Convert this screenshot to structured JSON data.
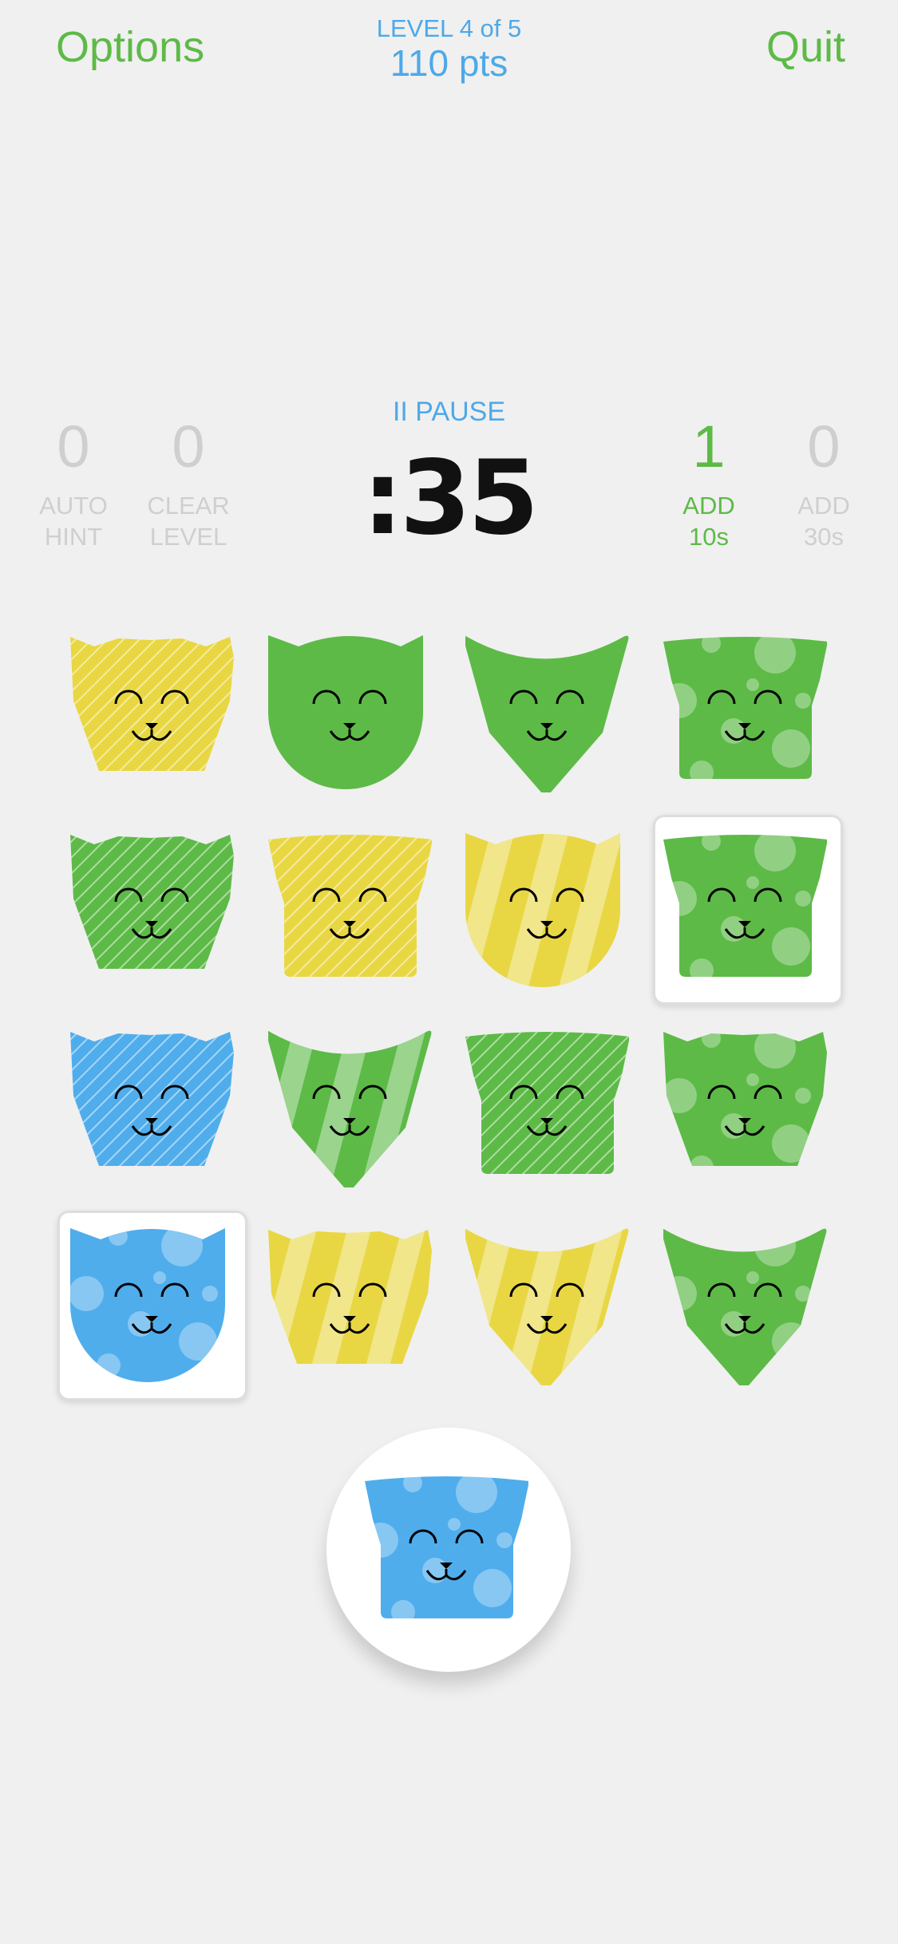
{
  "header": {
    "options_label": "Options",
    "quit_label": "Quit",
    "level_text": "LEVEL 4 of 5",
    "points_text": "110 pts"
  },
  "powerups": [
    {
      "count": "0",
      "line1": "AUTO",
      "line2": "HINT",
      "active": false
    },
    {
      "count": "0",
      "line1": "CLEAR",
      "line2": "LEVEL",
      "active": false
    },
    {
      "count": "1",
      "line1": "ADD",
      "line2": "10s",
      "active": true
    },
    {
      "count": "0",
      "line1": "ADD",
      "line2": "30s",
      "active": false
    }
  ],
  "timer": {
    "pause_label": "II PAUSE",
    "time_text": ":35"
  },
  "colors": {
    "green": "#5dba47",
    "yellow": "#e8d743",
    "blue": "#4fadec",
    "accent_blue": "#4da9e8",
    "inactive_grey": "#cfcfcf"
  },
  "grid": [
    {
      "shape": "pointy-ears",
      "color": "yellow",
      "pattern": "lines",
      "selected": false
    },
    {
      "shape": "round-ears",
      "color": "green",
      "pattern": "plain",
      "selected": false
    },
    {
      "shape": "v-wide",
      "color": "green",
      "pattern": "plain",
      "selected": false
    },
    {
      "shape": "box-taper",
      "color": "green",
      "pattern": "dots",
      "selected": false
    },
    {
      "shape": "pointy-ears",
      "color": "green",
      "pattern": "lines",
      "selected": false
    },
    {
      "shape": "box-taper",
      "color": "yellow",
      "pattern": "lines",
      "selected": false
    },
    {
      "shape": "round-ears",
      "color": "yellow",
      "pattern": "stripes",
      "selected": false
    },
    {
      "shape": "box-taper",
      "color": "green",
      "pattern": "dots",
      "selected": true
    },
    {
      "shape": "pointy-ears",
      "color": "blue",
      "pattern": "lines",
      "selected": false
    },
    {
      "shape": "v-wide",
      "color": "green",
      "pattern": "stripes",
      "selected": false
    },
    {
      "shape": "box-taper",
      "color": "green",
      "pattern": "lines",
      "selected": false
    },
    {
      "shape": "pointy-ears",
      "color": "green",
      "pattern": "dots",
      "selected": false
    },
    {
      "shape": "round-ears",
      "color": "blue",
      "pattern": "dots",
      "selected": true
    },
    {
      "shape": "pointy-ears",
      "color": "yellow",
      "pattern": "stripes",
      "selected": false
    },
    {
      "shape": "v-wide",
      "color": "yellow",
      "pattern": "stripes",
      "selected": false
    },
    {
      "shape": "v-wide",
      "color": "green",
      "pattern": "dots",
      "selected": false
    }
  ],
  "next_tile": {
    "shape": "box-taper",
    "color": "blue",
    "pattern": "dots"
  }
}
